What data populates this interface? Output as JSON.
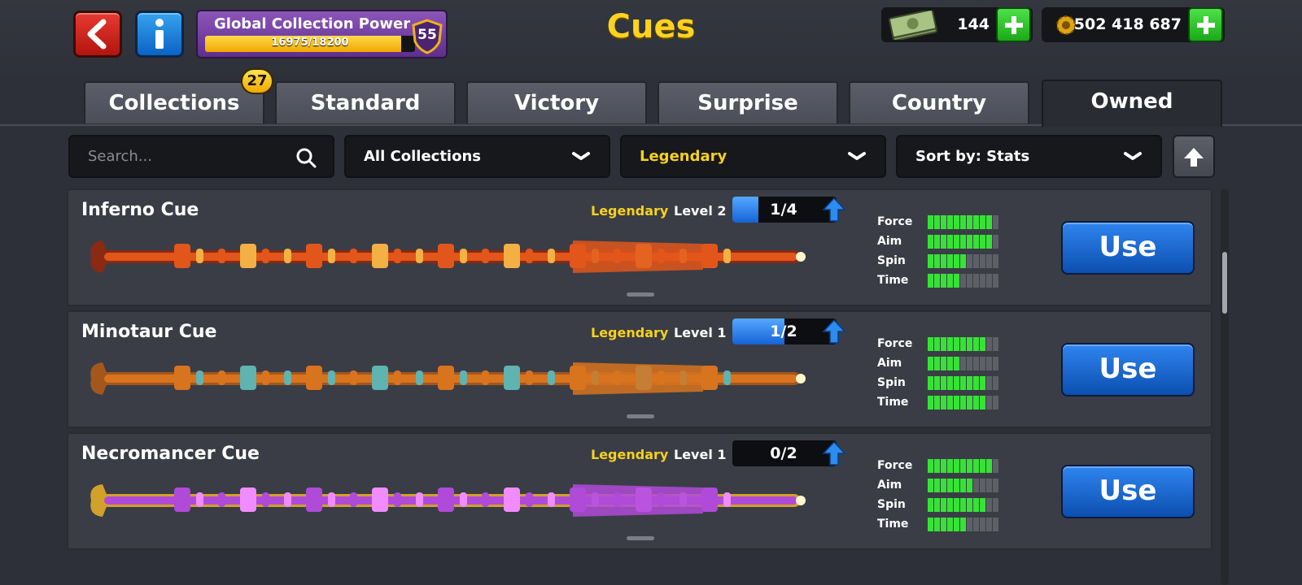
{
  "header": {
    "title": "Cues",
    "power": {
      "label": "Global Collection Power",
      "progress_text": "16975/18200",
      "current": 16975,
      "max": 18200,
      "level": "55"
    },
    "cash": "144",
    "coins": "502 418 687"
  },
  "tabs": [
    {
      "label": "Collections",
      "badge": "27"
    },
    {
      "label": "Standard"
    },
    {
      "label": "Victory"
    },
    {
      "label": "Surprise"
    },
    {
      "label": "Country"
    },
    {
      "label": "Owned",
      "active": true
    }
  ],
  "filters": {
    "search_placeholder": "Search...",
    "collection": "All Collections",
    "rarity": "Legendary",
    "sort": "Sort by: Stats"
  },
  "stat_labels": [
    "Force",
    "Aim",
    "Spin",
    "Time"
  ],
  "cues": [
    {
      "name": "Inferno Cue",
      "rarity": "Legendary",
      "level": "Level 2",
      "progress": "1/4",
      "progress_fraction": 0.25,
      "stats": [
        10,
        10,
        6,
        5
      ],
      "button": "Use",
      "palette": [
        "#e2561b",
        "#f3b044",
        "#8a2a12"
      ]
    },
    {
      "name": "Minotaur Cue",
      "rarity": "Legendary",
      "level": "Level 1",
      "progress": "1/2",
      "progress_fraction": 0.5,
      "stats": [
        9,
        5,
        9,
        9
      ],
      "button": "Use",
      "palette": [
        "#d8731e",
        "#5fb3b0",
        "#a4571d"
      ]
    },
    {
      "name": "Necromancer Cue",
      "rarity": "Legendary",
      "level": "Level 1",
      "progress": "0/2",
      "progress_fraction": 0,
      "stats": [
        10,
        7,
        9,
        6
      ],
      "button": "Use",
      "palette": [
        "#b04ad8",
        "#f08cff",
        "#d2a12a"
      ]
    }
  ],
  "max_stat": 11,
  "colors": {
    "accent": "#ffd21f",
    "legendary": "#f7d21d",
    "stat_on": "#37e237",
    "use_button": "#1c6ad8"
  }
}
